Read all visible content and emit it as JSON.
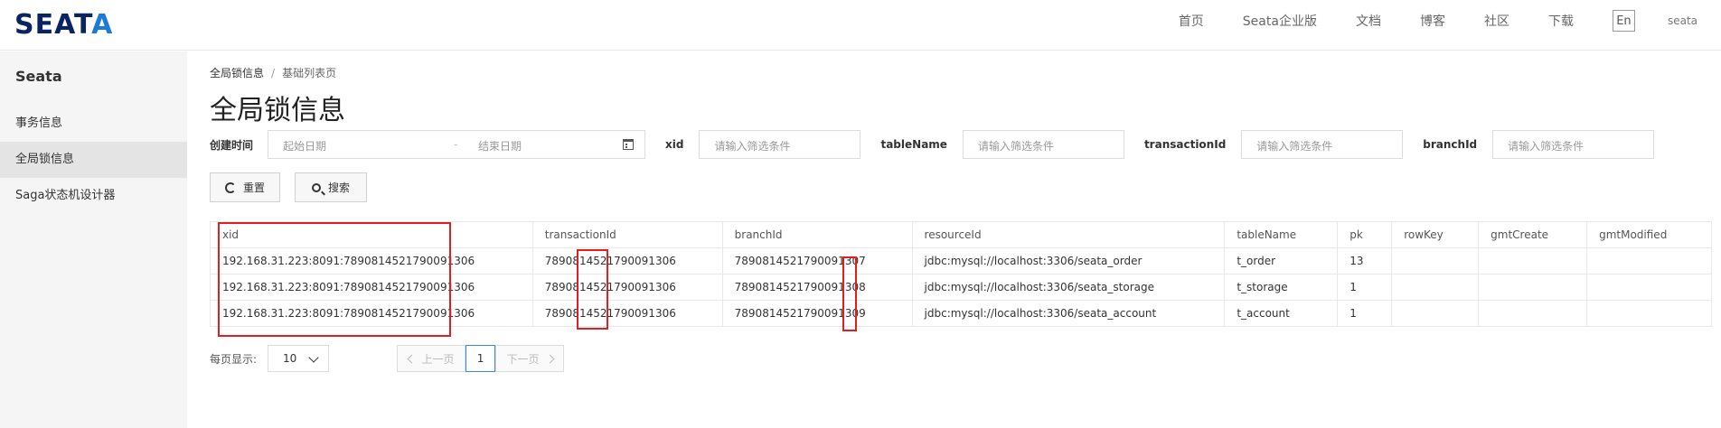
{
  "logo": {
    "text_pre": "SEAT",
    "text_accent": "A"
  },
  "nav": {
    "items": [
      "首页",
      "Seata企业版",
      "文档",
      "博客",
      "社区",
      "下载"
    ],
    "lang": "En",
    "user": "seata"
  },
  "sidebar": {
    "brand": "Seata",
    "items": [
      {
        "label": "事务信息"
      },
      {
        "label": "全局锁信息"
      },
      {
        "label": "Saga状态机设计器"
      }
    ]
  },
  "breadcrumb": {
    "parent": "全局锁信息",
    "sep": "/",
    "current": "基础列表页"
  },
  "page_title": "全局锁信息",
  "filters": {
    "created_label": "创建时间",
    "start_placeholder": "起始日期",
    "range_sep": "-",
    "end_placeholder": "结束日期",
    "xid_label": "xid",
    "xid_placeholder": "请输入筛选条件",
    "table_label": "tableName",
    "table_placeholder": "请输入筛选条件",
    "transaction_label": "transactionId",
    "transaction_placeholder": "请输入筛选条件",
    "branch_label": "branchId",
    "branch_placeholder": "请输入筛选条件"
  },
  "buttons": {
    "reset": "重置",
    "search": "搜索"
  },
  "table": {
    "headers": [
      "xid",
      "transactionId",
      "branchId",
      "resourceId",
      "tableName",
      "pk",
      "rowKey",
      "gmtCreate",
      "gmtModified"
    ],
    "rows": [
      [
        "192.168.31.223:8091:7890814521790091306",
        "7890814521790091306",
        "7890814521790091307",
        "jdbc:mysql://localhost:3306/seata_order",
        "t_order",
        "13",
        "",
        "",
        ""
      ],
      [
        "192.168.31.223:8091:7890814521790091306",
        "7890814521790091306",
        "7890814521790091308",
        "jdbc:mysql://localhost:3306/seata_storage",
        "t_storage",
        "1",
        "",
        "",
        ""
      ],
      [
        "192.168.31.223:8091:7890814521790091306",
        "7890814521790091306",
        "7890814521790091309",
        "jdbc:mysql://localhost:3306/seata_account",
        "t_account",
        "1",
        "",
        "",
        ""
      ]
    ]
  },
  "pagination": {
    "per_page_label": "每页显示:",
    "per_page": "10",
    "prev": "上一页",
    "current": "1",
    "next": "下一页"
  },
  "colors": {
    "highlight": "#e02020",
    "logo_dark": "#0a2463",
    "logo_accent": "#1a7bd8",
    "active_page_border": "#3c8ad8"
  }
}
